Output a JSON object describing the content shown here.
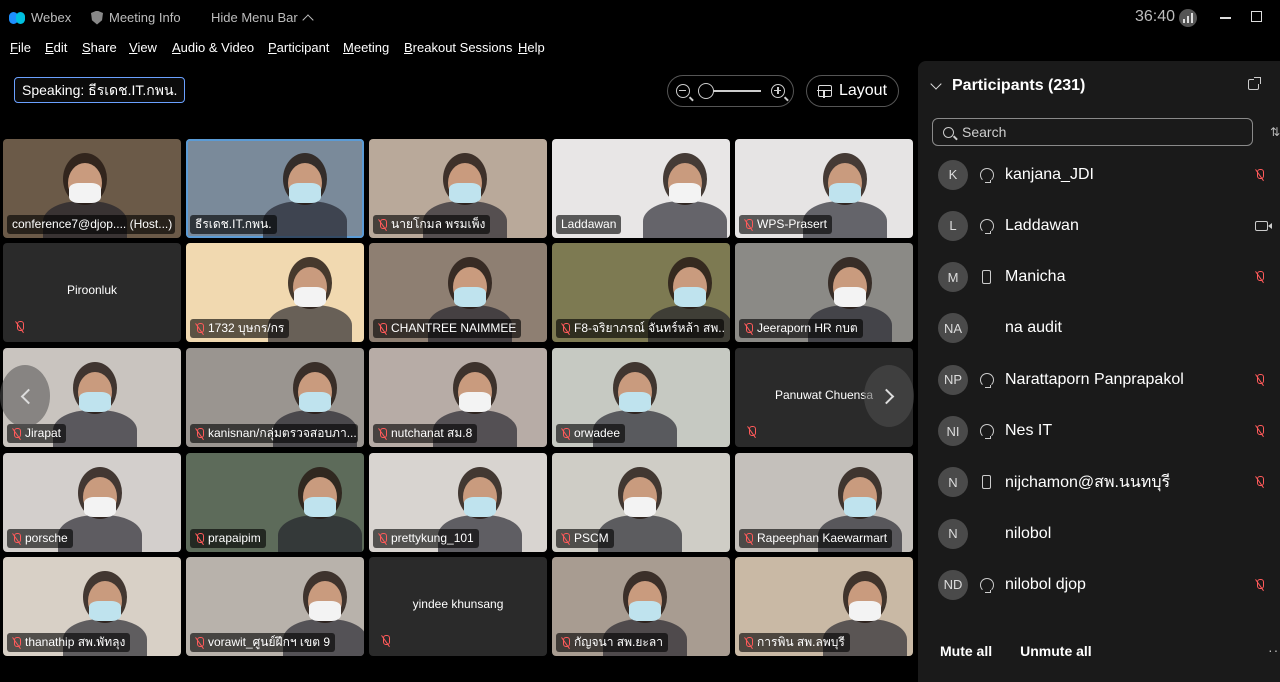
{
  "titlebar": {
    "app_name": "Webex",
    "meeting_info": "Meeting Info",
    "hide_menu": "Hide Menu Bar",
    "timer": "36:40"
  },
  "menu": [
    "File",
    "Edit",
    "Share",
    "View",
    "Audio & Video",
    "Participant",
    "Meeting",
    "Breakout Sessions",
    "Help"
  ],
  "speaking": "Speaking: ธีรเดช.IT.กพน.",
  "layout_button": "Layout",
  "tiles": [
    {
      "name": "conference7@djop.... (Host...)",
      "muted": false,
      "video": true,
      "bg": "#6b5a48"
    },
    {
      "name": "ธีรเดช.IT.กพน.",
      "muted": false,
      "video": true,
      "bg": "#7a8a9a",
      "active": true
    },
    {
      "name": "นายโกมล พรมเพ็ง",
      "muted": true,
      "video": true,
      "bg": "#b9a99a"
    },
    {
      "name": "Laddawan",
      "muted": false,
      "video": true,
      "bg": "#e8e6e6"
    },
    {
      "name": "WPS-Prasert",
      "muted": true,
      "video": true,
      "bg": "#e6e4e4"
    },
    {
      "name": "Piroonluk",
      "muted": true,
      "video": false
    },
    {
      "name": "1732 บุษกร/กร",
      "muted": true,
      "video": true,
      "bg": "#f1d9b0"
    },
    {
      "name": "CHANTREE NAIMMEE",
      "muted": true,
      "video": true,
      "bg": "#8e7f72"
    },
    {
      "name": "F8-จริยาภรณ์ จันทร์หล้า สพ....",
      "muted": true,
      "video": true,
      "bg": "#7d7a52"
    },
    {
      "name": "Jeeraporn HR กบต",
      "muted": true,
      "video": true,
      "bg": "#8b8a86"
    },
    {
      "name": "Jirapat",
      "muted": true,
      "video": true,
      "bg": "#c9c4bf"
    },
    {
      "name": "kanisnan/กลุ่มตรวจสอบภา...",
      "muted": true,
      "video": true,
      "bg": "#9a9590"
    },
    {
      "name": "nutchanat สม.8",
      "muted": true,
      "video": true,
      "bg": "#b7aca6"
    },
    {
      "name": "orwadee",
      "muted": true,
      "video": true,
      "bg": "#c6c9c2"
    },
    {
      "name": "Panuwat Chuensa",
      "muted": true,
      "video": false
    },
    {
      "name": "porsche",
      "muted": true,
      "video": true,
      "bg": "#d3cfcc"
    },
    {
      "name": "prapaipim",
      "muted": true,
      "video": true,
      "bg": "#5d6b5a"
    },
    {
      "name": "prettykung_101",
      "muted": true,
      "video": true,
      "bg": "#d8d4d0"
    },
    {
      "name": "PSCM",
      "muted": true,
      "video": true,
      "bg": "#cfcdc6"
    },
    {
      "name": "Rapeephan Kaewarmart",
      "muted": true,
      "video": true,
      "bg": "#c4c0bb"
    },
    {
      "name": "thanathip สพ.พัทลุง",
      "muted": true,
      "video": true,
      "bg": "#d8d0c6"
    },
    {
      "name": "vorawit_ศูนย์ฝึกฯ เขต 9",
      "muted": true,
      "video": true,
      "bg": "#b8b2ab"
    },
    {
      "name": "yindee khunsang",
      "muted": true,
      "video": false
    },
    {
      "name": "กัญจนา สพ.ยะลา",
      "muted": true,
      "video": true,
      "bg": "#a89c91"
    },
    {
      "name": "การพิน สพ.ลพบุรี",
      "muted": true,
      "video": true,
      "bg": "#c9b9a5"
    }
  ],
  "panel": {
    "title": "Participants (231)",
    "search_placeholder": "Search",
    "participants": [
      {
        "initials": "K",
        "name": "kanjana_JDI",
        "device": "headset",
        "status": "muted"
      },
      {
        "initials": "L",
        "name": "Laddawan",
        "device": "headset",
        "status": "camera"
      },
      {
        "initials": "M",
        "name": "Manicha",
        "device": "phone",
        "status": "muted"
      },
      {
        "initials": "NA",
        "name": "na audit",
        "device": "none",
        "status": "none"
      },
      {
        "initials": "NP",
        "name": "Narattaporn Panprapakol",
        "device": "headset",
        "status": "muted"
      },
      {
        "initials": "NI",
        "name": "Nes IT",
        "device": "headset",
        "status": "muted"
      },
      {
        "initials": "N",
        "name": "nijchamon@สพ.นนทบุรี",
        "device": "phone",
        "status": "muted"
      },
      {
        "initials": "N",
        "name": "nilobol",
        "device": "none",
        "status": "none"
      },
      {
        "initials": "ND",
        "name": "nilobol djop",
        "device": "headset",
        "status": "muted"
      }
    ],
    "mute_all": "Mute all",
    "unmute_all": "Unmute all"
  },
  "icons": {
    "app": "webex-logo-icon",
    "meeting_info": "shield-icon",
    "zoom_out": "zoom-out-icon",
    "zoom_in": "zoom-in-icon",
    "layout": "layout-icon",
    "mic_muted": "mic-muted-icon",
    "headset": "headset-icon",
    "phone": "phone-icon",
    "camera": "camera-icon"
  },
  "colors": {
    "accent": "#5b9bd5",
    "muted_red": "#ff5a5a",
    "panel_bg": "#1a1a1a"
  }
}
